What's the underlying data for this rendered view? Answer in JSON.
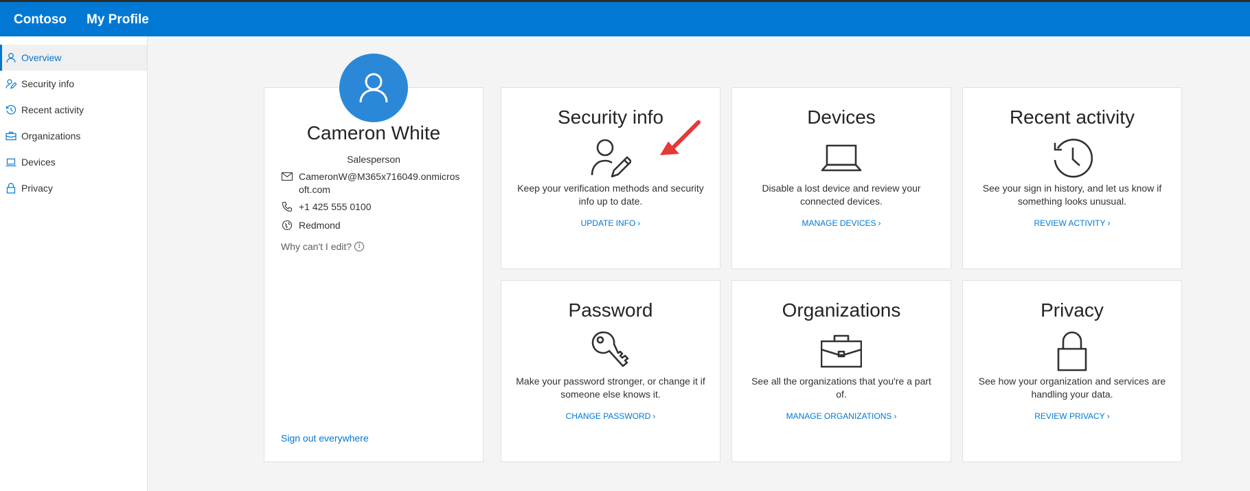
{
  "header": {
    "brand": "Contoso",
    "app_title": "My Profile"
  },
  "colors": {
    "accent": "#0078d4",
    "avatar": "#2b88d8",
    "annotation_arrow": "#e53935"
  },
  "sidebar": {
    "items": [
      {
        "label": "Overview",
        "icon": "person-icon",
        "active": true
      },
      {
        "label": "Security info",
        "icon": "person-edit-icon"
      },
      {
        "label": "Recent activity",
        "icon": "history-icon"
      },
      {
        "label": "Organizations",
        "icon": "briefcase-icon"
      },
      {
        "label": "Devices",
        "icon": "laptop-icon"
      },
      {
        "label": "Privacy",
        "icon": "lock-icon"
      }
    ]
  },
  "profile": {
    "name": "Cameron White",
    "role": "Salesperson",
    "email": "CameronW@M365x716049.onmicrosoft.com",
    "phone": "+1 425 555 0100",
    "location": "Redmond",
    "why_edit": "Why can't I edit?",
    "sign_out": "Sign out everywhere"
  },
  "tiles": [
    {
      "title": "Security info",
      "icon": "person-edit-icon",
      "description": "Keep your verification methods and security info up to date.",
      "link": "UPDATE INFO"
    },
    {
      "title": "Devices",
      "icon": "laptop-icon",
      "description": "Disable a lost device and review your connected devices.",
      "link": "MANAGE DEVICES"
    },
    {
      "title": "Recent activity",
      "icon": "history-icon",
      "description": "See your sign in history, and let us know if something looks unusual.",
      "link": "REVIEW ACTIVITY"
    },
    {
      "title": "Password",
      "icon": "key-icon",
      "description": "Make your password stronger, or change it if someone else knows it.",
      "link": "CHANGE PASSWORD"
    },
    {
      "title": "Organizations",
      "icon": "briefcase-icon",
      "description": "See all the organizations that you're a part of.",
      "link": "MANAGE ORGANIZATIONS"
    },
    {
      "title": "Privacy",
      "icon": "lock-icon",
      "description": "See how your organization and services are handling your data.",
      "link": "REVIEW PRIVACY"
    }
  ]
}
